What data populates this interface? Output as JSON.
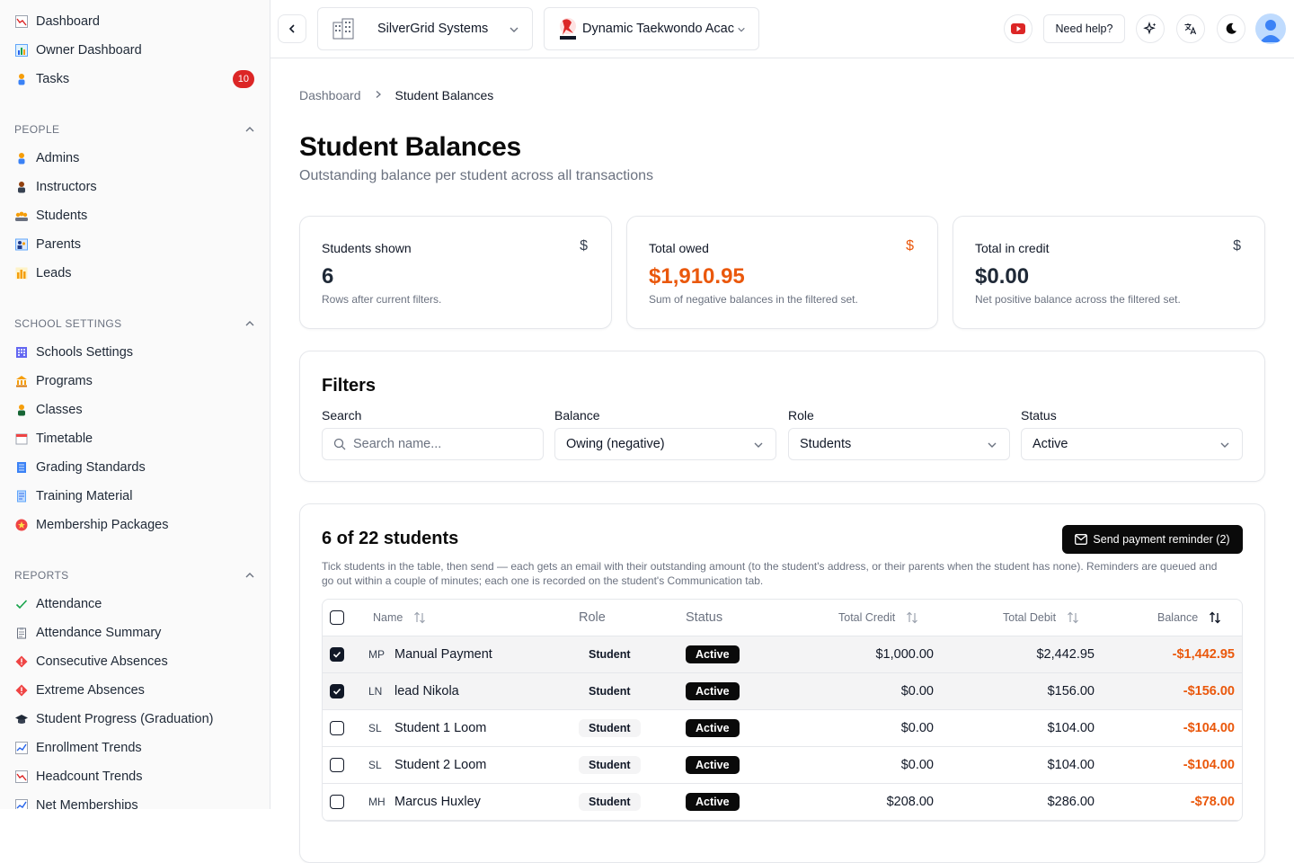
{
  "sidebar": {
    "top_items": [
      {
        "label": "Dashboard",
        "icon": "chart-down-icon"
      },
      {
        "label": "Owner Dashboard",
        "icon": "bar-chart-icon"
      },
      {
        "label": "Tasks",
        "icon": "person-icon",
        "badge": "10"
      }
    ],
    "sections": [
      {
        "title": "PEOPLE",
        "items": [
          {
            "label": "Admins",
            "icon": "person-icon"
          },
          {
            "label": "Instructors",
            "icon": "instructor-icon"
          },
          {
            "label": "Students",
            "icon": "students-icon"
          },
          {
            "label": "Parents",
            "icon": "parents-icon"
          },
          {
            "label": "Leads",
            "icon": "bar-chart-icon"
          }
        ]
      },
      {
        "title": "SCHOOL SETTINGS",
        "items": [
          {
            "label": "Schools Settings",
            "icon": "building-icon"
          },
          {
            "label": "Programs",
            "icon": "bank-icon"
          },
          {
            "label": "Classes",
            "icon": "class-icon"
          },
          {
            "label": "Timetable",
            "icon": "calendar-icon"
          },
          {
            "label": "Grading Standards",
            "icon": "ledger-icon"
          },
          {
            "label": "Training Material",
            "icon": "document-icon"
          },
          {
            "label": "Membership Packages",
            "icon": "star-badge-icon"
          }
        ]
      },
      {
        "title": "REPORTS",
        "items": [
          {
            "label": "Attendance",
            "icon": "check-icon"
          },
          {
            "label": "Attendance Summary",
            "icon": "clipboard-icon"
          },
          {
            "label": "Consecutive Absences",
            "icon": "diamond-alert-icon"
          },
          {
            "label": "Extreme Absences",
            "icon": "diamond-alert-icon"
          },
          {
            "label": "Student Progress (Graduation)",
            "icon": "graduation-icon"
          },
          {
            "label": "Enrollment Trends",
            "icon": "trend-icon"
          },
          {
            "label": "Headcount Trends",
            "icon": "chart-down-icon"
          },
          {
            "label": "Net Memberships",
            "icon": "trend-icon"
          }
        ]
      }
    ]
  },
  "topbar": {
    "org_name": "SilverGrid Systems",
    "school_name": "Dynamic Taekwondo Acac",
    "help_label": "Need help?"
  },
  "breadcrumb": {
    "root": "Dashboard",
    "current": "Student Balances"
  },
  "page": {
    "title": "Student Balances",
    "subtitle": "Outstanding balance per student across all transactions"
  },
  "stats": [
    {
      "title": "Students shown",
      "value": "6",
      "desc": "Rows after current filters.",
      "icon": "$"
    },
    {
      "title": "Total owed",
      "value": "$1,910.95",
      "desc": "Sum of negative balances in the filtered set.",
      "icon": "$"
    },
    {
      "title": "Total in credit",
      "value": "$0.00",
      "desc": "Net positive balance across the filtered set.",
      "icon": "$"
    }
  ],
  "filters": {
    "title": "Filters",
    "search_label": "Search",
    "search_placeholder": "Search name...",
    "balance_label": "Balance",
    "balance_value": "Owing (negative)",
    "role_label": "Role",
    "role_value": "Students",
    "status_label": "Status",
    "status_value": "Active"
  },
  "table": {
    "title": "6 of 22 students",
    "send_label": "Send payment reminder (2)",
    "note": "Tick students in the table, then send — each gets an email with their outstanding amount (to the student's address, or their parents when the student has none). Reminders are queued and go out within a couple of minutes; each one is recorded on the student's Communication tab.",
    "columns": {
      "name": "Name",
      "role": "Role",
      "status": "Status",
      "credit": "Total Credit",
      "debit": "Total Debit",
      "balance": "Balance"
    },
    "rows": [
      {
        "checked": true,
        "initials": "MP",
        "name": "Manual Payment",
        "role": "Student",
        "status": "Active",
        "credit": "$1,000.00",
        "debit": "$2,442.95",
        "balance": "-$1,442.95"
      },
      {
        "checked": true,
        "initials": "LN",
        "name": "lead Nikola",
        "role": "Student",
        "status": "Active",
        "credit": "$0.00",
        "debit": "$156.00",
        "balance": "-$156.00"
      },
      {
        "checked": false,
        "initials": "SL",
        "name": "Student 1 Loom",
        "role": "Student",
        "status": "Active",
        "credit": "$0.00",
        "debit": "$104.00",
        "balance": "-$104.00"
      },
      {
        "checked": false,
        "initials": "SL",
        "name": "Student 2 Loom",
        "role": "Student",
        "status": "Active",
        "credit": "$0.00",
        "debit": "$104.00",
        "balance": "-$104.00"
      },
      {
        "checked": false,
        "initials": "MH",
        "name": "Marcus Huxley",
        "role": "Student",
        "status": "Active",
        "credit": "$208.00",
        "debit": "$286.00",
        "balance": "-$78.00"
      }
    ]
  },
  "colors": {
    "accent_orange": "#ea580c",
    "badge_red": "#dc2626",
    "primary": "#0a0a0a"
  }
}
